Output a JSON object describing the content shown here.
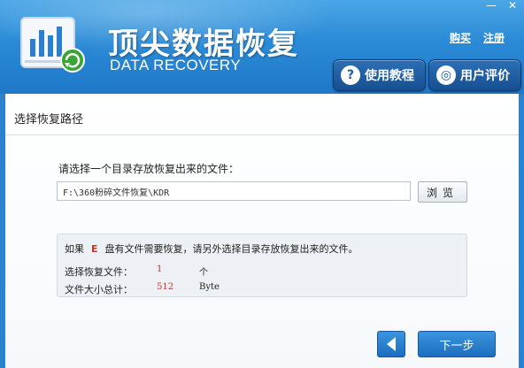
{
  "header": {
    "title_cn": "顶尖数据恢复",
    "title_en": "DATA RECOVERY",
    "links": {
      "buy": "购买",
      "register": "注册"
    },
    "window": {
      "minimize": "—",
      "close": "✕"
    },
    "buttons": {
      "tutorial": {
        "label": "使用教程",
        "icon": "?"
      },
      "review": {
        "label": "用户评价",
        "icon": "◎"
      }
    }
  },
  "main": {
    "section_title": "选择恢复路径",
    "prompt": "请选择一个目录存放恢复出来的文件：",
    "path_value": "F:\\360粉碎文件恢复\\KDR",
    "browse_label": "浏览",
    "info": {
      "prefix": "如果",
      "drive": "E",
      "suffix": "盘有文件需要恢复，请另外选择目录存放恢复出来的文件。",
      "count_label": "选择恢复文件：",
      "count_value": "1",
      "count_unit": "个",
      "size_label": "文件大小总计：",
      "size_value": "512",
      "size_unit": "Byte"
    },
    "next_label": "下一步"
  },
  "colors": {
    "header_blue": "#2b8ad6",
    "button_blue": "#1c6ec0",
    "accent_red": "#c0392b"
  }
}
